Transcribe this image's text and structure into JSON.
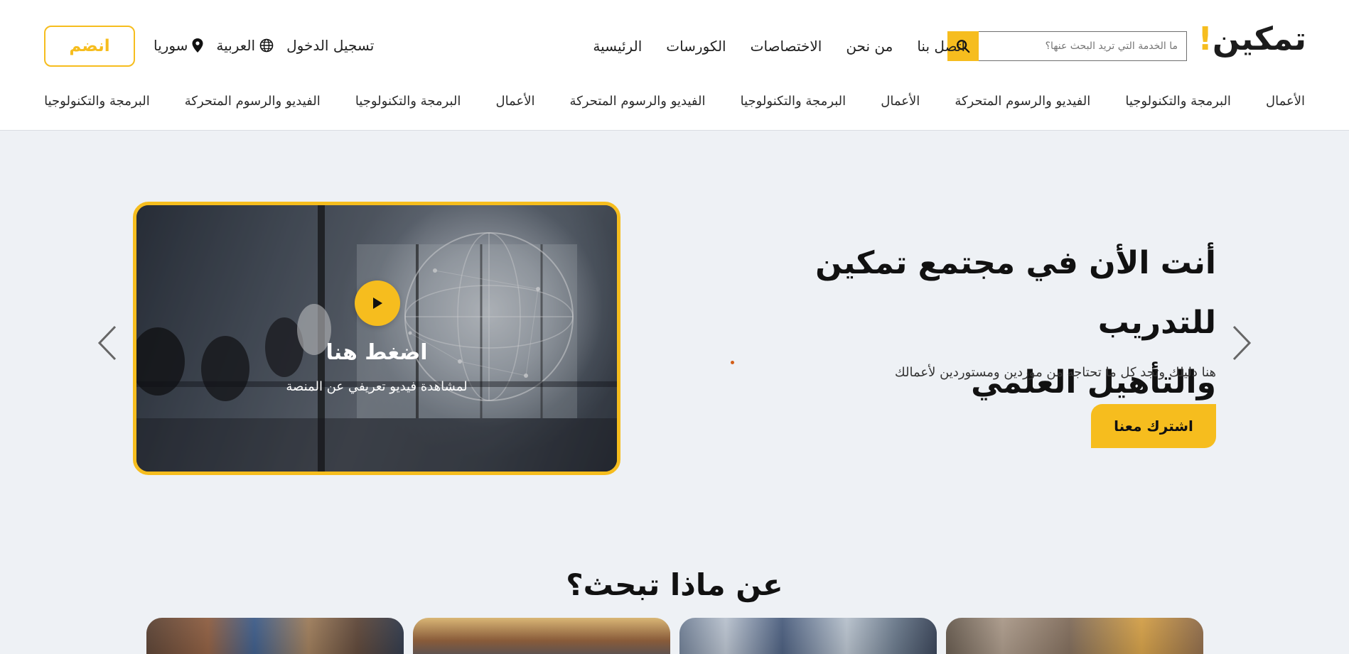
{
  "brand": {
    "logo_text": "تمكين",
    "logo_mark": "!",
    "accent_color": "#f6bd1e"
  },
  "search": {
    "placeholder": "ما الخدمة التي تريد البحث عنها؟",
    "value": ""
  },
  "top_nav": [
    "الرئيسية",
    "الكورسات",
    "الاختصاصات",
    "من نحن",
    "اتصل بنا"
  ],
  "utility": {
    "country": "سوريا",
    "language": "العربية",
    "login": "تسجيل الدخول",
    "join": "انضم"
  },
  "category_nav": [
    "الأعمال",
    "البرمجة والتكنولوجيا",
    "الفيديو والرسوم المتحركة",
    "الأعمال",
    "البرمجة والتكنولوجيا",
    "الفيديو والرسوم المتحركة",
    "الأعمال",
    "البرمجة والتكنولوجيا",
    "الفيديو والرسوم المتحركة",
    "البرمجة والتكنولوجيا"
  ],
  "hero": {
    "title_line1": "أنت الأن في مجتمع تمكين للتدريب",
    "title_line2": "والتأهيل العلمي",
    "description": "هنا دليلك وتجد كل ما تحتاجه من موردين ومستوردين لأعمالك",
    "cta": "اشترك معنا",
    "video": {
      "title": "اضغط هنا",
      "subtitle": "لمشاهدة فيديو تعريفي عن المنصة"
    }
  },
  "section": {
    "heading": "عن ماذا تبحث؟"
  },
  "icons": {
    "search": "search-icon",
    "location": "location-pin-icon",
    "language": "globe-icon",
    "play": "play-icon",
    "prev": "chevron-left-icon",
    "next": "chevron-right-icon"
  }
}
